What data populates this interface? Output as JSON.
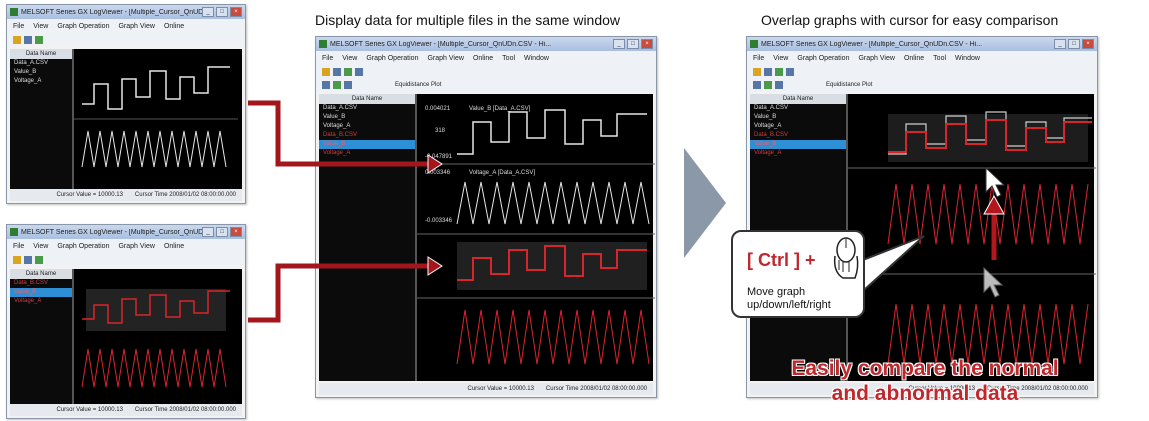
{
  "captions": {
    "center": "Display data for multiple files in the same window",
    "right": "Overlap graphs with cursor for easy comparison"
  },
  "window": {
    "title": "MELSOFT Series GX LogViewer - [Multiple_Cursor_QnUDn.CSV - Hi...",
    "menu": [
      "File",
      "View",
      "Graph Operation",
      "Graph View",
      "Online",
      "Tool",
      "Window"
    ],
    "plot_mode": "Equidistance Plot",
    "tree_header": "Data Name",
    "tree_items": [
      "Data_A.CSV",
      "Value_B",
      "Voltage_A",
      "Data_B.CSV",
      "Value_B",
      "Voltage_A"
    ],
    "graph_labels": {
      "value_top": "0.004021",
      "value_mid": "Value_B [Data_A.CSV]",
      "value_low": "-0.047891",
      "voltage_top": "0.003346",
      "voltage_mid": "Voltage_A [Data_A.CSV]",
      "voltage_low": "-0.003346",
      "tick_0": "318"
    },
    "status": {
      "cursor_value": "Cursor Value = 10000.13",
      "cursor_time": "Cursor Time 2008/01/02 08:00:00.000"
    }
  },
  "callout": {
    "key": "[ Ctrl ] +",
    "hint": "Move graph up/down/left/right"
  },
  "banner": "Easily compare the normal and abnormal data",
  "colors": {
    "accent_red": "#c0282d",
    "trace_white": "#e6e6e6",
    "trace_red": "#d7262b",
    "arrow_gray": "#8b98a8"
  }
}
